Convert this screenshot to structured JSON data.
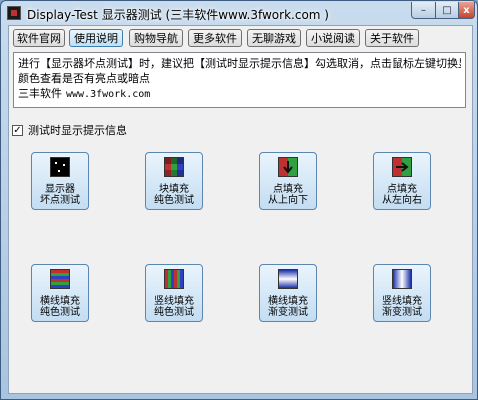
{
  "window": {
    "title": "Display-Test 显示器测试 (三丰软件www.3fwork.com )",
    "minimize": "–",
    "maximize": "□",
    "close": "x"
  },
  "toolbar": {
    "buttons": [
      "软件官网",
      "使用说明",
      "购物导航",
      "更多软件",
      "无聊游戏",
      "小说阅读",
      "关于软件"
    ],
    "active": "使用说明"
  },
  "info": {
    "line1": "进行【显示器坏点测试】时，建议把【测试时显示提示信息】勾选取消，点击鼠标左键切换显示",
    "line2": "颜色查看是否有亮点或暗点",
    "line3_name": "三丰软件",
    "line3_url": "www.3fwork.com"
  },
  "checkbox": {
    "label": "测试时显示提示信息",
    "checked": true
  },
  "tests": [
    {
      "line1": "显示器",
      "line2": "坏点测试",
      "icon": "dead-pixel-icon"
    },
    {
      "line1": "块填充",
      "line2": "纯色测试",
      "icon": "block-fill-icon"
    },
    {
      "line1": "点填充",
      "line2": "从上向下",
      "icon": "dot-fill-down-icon"
    },
    {
      "line1": "点填充",
      "line2": "从左向右",
      "icon": "dot-fill-right-icon"
    },
    {
      "line1": "横线填充",
      "line2": "纯色测试",
      "icon": "horizontal-line-fill-icon"
    },
    {
      "line1": "竖线填充",
      "line2": "纯色测试",
      "icon": "vertical-line-fill-icon"
    },
    {
      "line1": "横线填充",
      "line2": "渐变测试",
      "icon": "horizontal-gradient-icon"
    },
    {
      "line1": "竖线填充",
      "line2": "渐变测试",
      "icon": "vertical-gradient-icon"
    }
  ]
}
